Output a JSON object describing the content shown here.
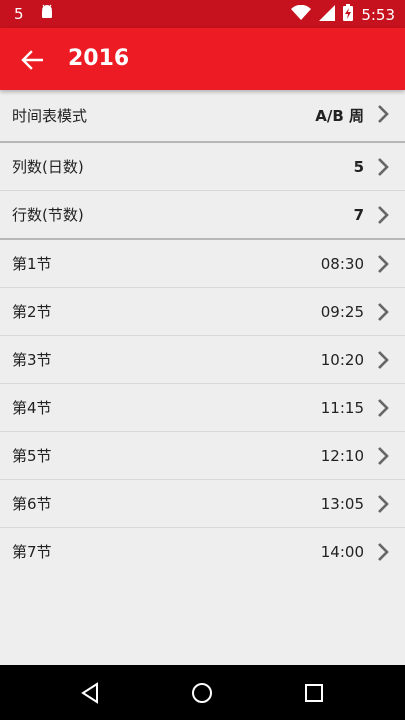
{
  "status_bar": {
    "notification_count": "5",
    "time": "5:53",
    "icons": [
      "android-icon",
      "wifi-icon",
      "signal-icon",
      "battery-charging-icon"
    ]
  },
  "app_bar": {
    "title": "2016",
    "back_icon": "arrow-left-icon"
  },
  "settings": [
    {
      "label": "时间表模式",
      "value": "A/B 周",
      "bold": true
    },
    {
      "label": "列数(日数)",
      "value": "5",
      "bold": true
    },
    {
      "label": "行数(节数)",
      "value": "7",
      "bold": true
    }
  ],
  "periods": [
    {
      "label": "第1节",
      "time": "08:30"
    },
    {
      "label": "第2节",
      "time": "09:25"
    },
    {
      "label": "第3节",
      "time": "10:20"
    },
    {
      "label": "第4节",
      "time": "11:15"
    },
    {
      "label": "第5节",
      "time": "12:10"
    },
    {
      "label": "第6节",
      "time": "13:05"
    },
    {
      "label": "第7节",
      "time": "14:00"
    }
  ],
  "nav_bar": {
    "buttons": [
      "back-triangle-icon",
      "home-circle-icon",
      "recents-square-icon"
    ]
  },
  "colors": {
    "accent": "#ed1c24",
    "status_bar": "#c5121e",
    "background": "#efeeef",
    "chevron": "#666666"
  }
}
